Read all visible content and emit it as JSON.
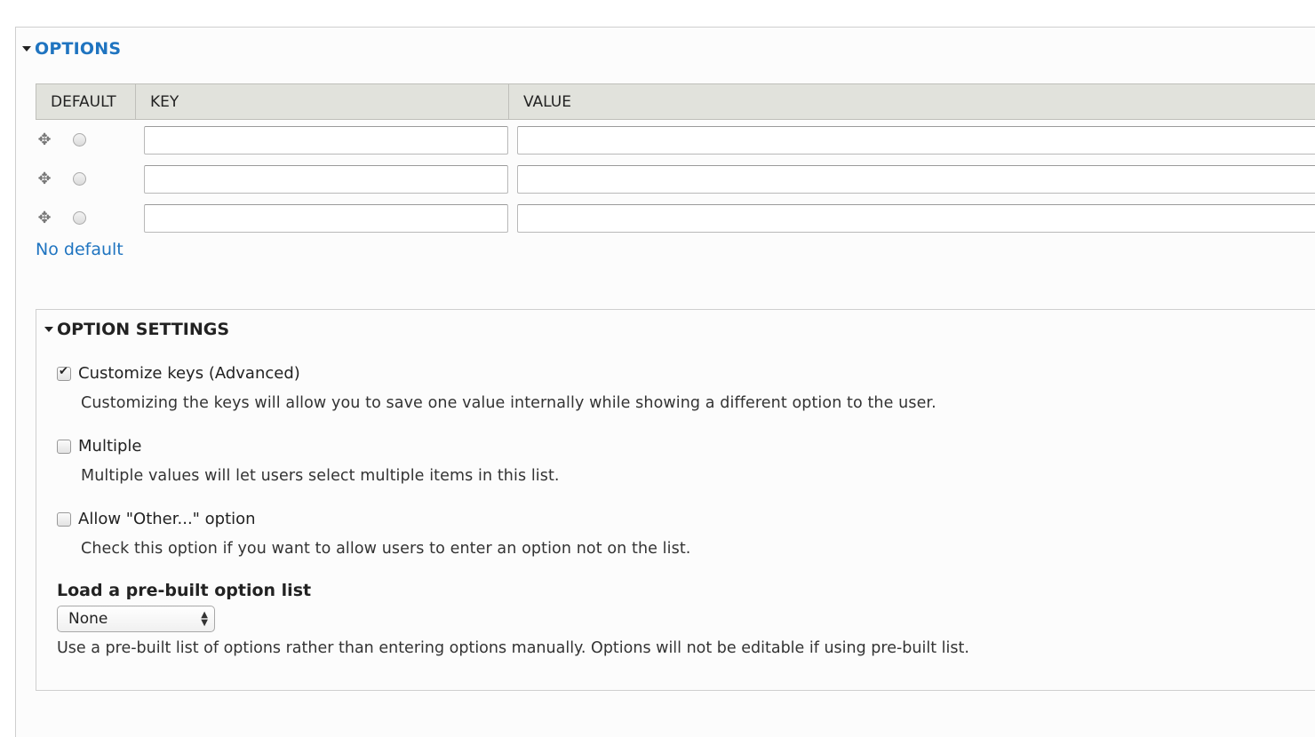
{
  "options": {
    "title": "OPTIONS",
    "columns": [
      "DEFAULT",
      "KEY",
      "VALUE"
    ],
    "rows": [
      {
        "key": "",
        "value": ""
      },
      {
        "key": "",
        "value": ""
      },
      {
        "key": "",
        "value": ""
      }
    ],
    "no_default_link": "No default"
  },
  "settings": {
    "title": "OPTION SETTINGS",
    "items": [
      {
        "label": "Customize keys (Advanced)",
        "checked": true,
        "description": "Customizing the keys will allow you to save one value internally while showing a different option to the user."
      },
      {
        "label": "Multiple",
        "checked": false,
        "description": "Multiple values will let users select multiple items in this list."
      },
      {
        "label": "Allow \"Other...\" option",
        "checked": false,
        "description": "Check this option if you want to allow users to enter an option not on the list."
      }
    ],
    "prebuilt": {
      "label": "Load a pre-built option list",
      "selected": "None",
      "description": "Use a pre-built list of options rather than entering options manually. Options will not be editable if using pre-built list."
    }
  },
  "icons": {
    "drag": "drag-handle-icon",
    "collapse": "triangle-down-icon",
    "select_arrows": "up-down-arrows-icon"
  },
  "colors": {
    "link": "#1f74c0",
    "header_bg": "#e1e2dc"
  }
}
